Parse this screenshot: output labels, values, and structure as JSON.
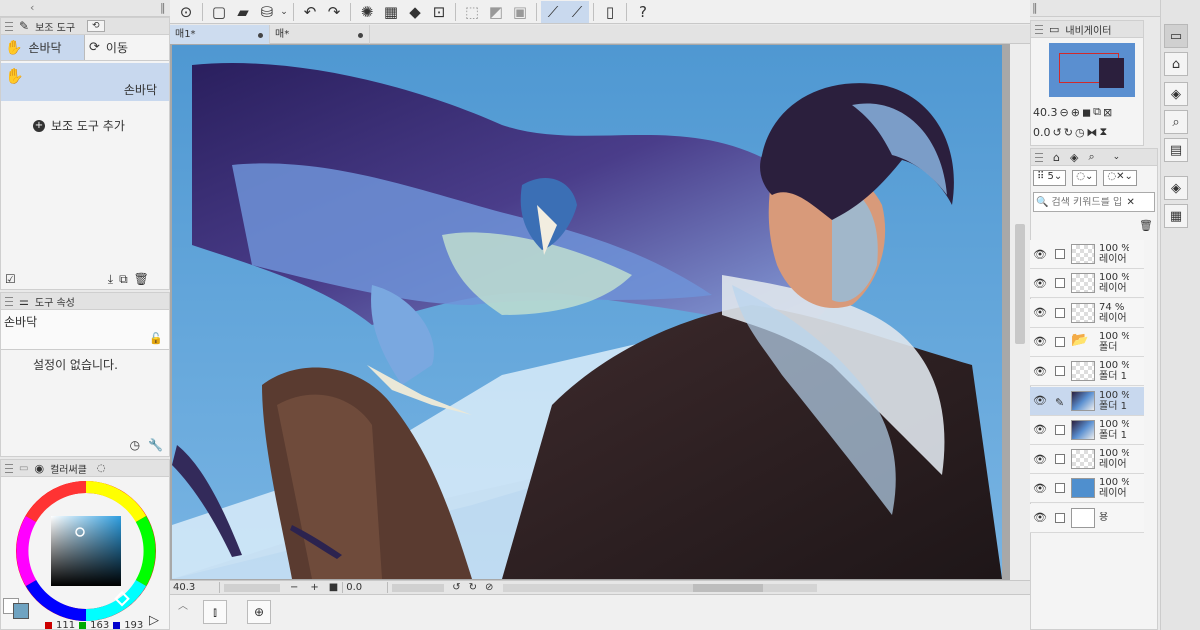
{
  "left": {
    "subtool_panel_title": "보조 도구",
    "subtool_tabs": [
      "손바닥",
      "이동"
    ],
    "subtool_selected": "손바닥",
    "add_subtool": "보조 도구 추가",
    "props_panel_title": "도구 속성",
    "props_tool_name": "손바닥",
    "props_empty": "설정이 없습니다.",
    "color_panel_title": "컬러써클",
    "rgb": {
      "r": "111",
      "g": "163",
      "b": "193"
    },
    "current_color": "#6fa3c1"
  },
  "toolbar": {
    "icons": [
      "clip-studio-logo-icon",
      "new-file-icon",
      "open-folder-icon",
      "save-icon",
      "undo-icon",
      "redo-icon",
      "loading-icon",
      "clear-icon",
      "fill-icon",
      "transform-icon",
      "deselect-icon",
      "invert-icon",
      "selection-border-icon",
      "pen-stabilize-icon",
      "brush-stabilize-icon",
      "smartphone-icon",
      "help-icon"
    ]
  },
  "canvas": {
    "tabs": [
      {
        "label": "매1*",
        "active": true
      },
      {
        "label": "매*",
        "active": false
      }
    ],
    "zoom": "40.3",
    "angle": "0.0"
  },
  "navigator": {
    "title": "내비게이터",
    "zoom": "40.3",
    "angle": "0.0"
  },
  "layers": {
    "search_placeholder": "검색 키워드를 입",
    "brush_size_label": "5",
    "rows": [
      {
        "opacity": "100 %",
        "name": "레이어",
        "thumb": "transparent",
        "selected": false,
        "pen": false
      },
      {
        "opacity": "100 %",
        "name": "레이어",
        "thumb": "transparent",
        "selected": false,
        "pen": false
      },
      {
        "opacity": "74 %",
        "name": "레이어",
        "thumb": "transparent",
        "selected": false,
        "pen": false
      },
      {
        "opacity": "100 %",
        "name": "폴더",
        "thumb": "folder",
        "selected": false,
        "pen": false
      },
      {
        "opacity": "100 %",
        "name": "폴더 1",
        "thumb": "transparent",
        "selected": false,
        "pen": false
      },
      {
        "opacity": "100 %",
        "name": "폴더 1",
        "thumb": "art",
        "selected": true,
        "pen": true
      },
      {
        "opacity": "100 %",
        "name": "폴더 1",
        "thumb": "art",
        "selected": false,
        "pen": false
      },
      {
        "opacity": "100 %",
        "name": "레이어",
        "thumb": "transparent",
        "selected": false,
        "pen": false
      },
      {
        "opacity": "100 %",
        "name": "레이어",
        "thumb": "blue",
        "selected": false,
        "pen": false
      },
      {
        "opacity": "",
        "name": "용",
        "thumb": "white",
        "selected": false,
        "pen": false
      }
    ]
  }
}
